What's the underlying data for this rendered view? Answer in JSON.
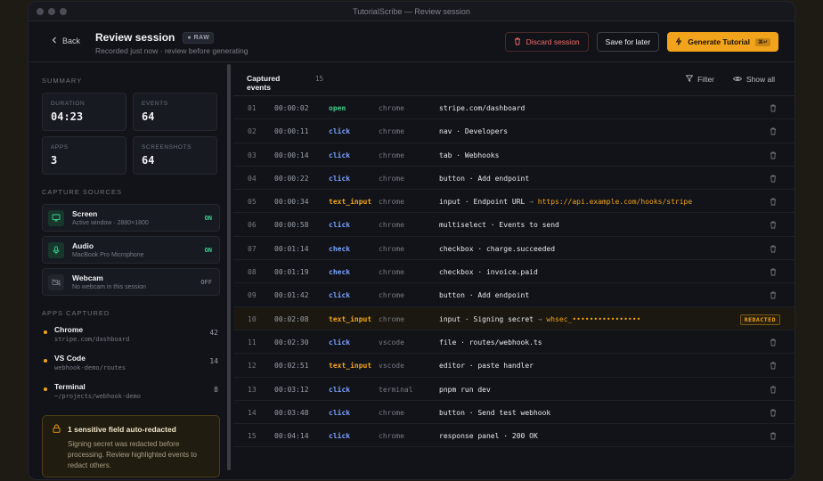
{
  "window": {
    "title": "TutorialScribe — Review session"
  },
  "header": {
    "back": "Back",
    "title": "Review session",
    "badge": "RAW",
    "subtitle": "Recorded just now · review before generating",
    "discard": "Discard session",
    "save": "Save for later",
    "generate": "Generate Tutorial",
    "generate_kbd": "⌘↵"
  },
  "sidebar": {
    "summary_label": "SUMMARY",
    "stats": [
      {
        "label": "DURATION",
        "value": "04:23"
      },
      {
        "label": "EVENTS",
        "value": "64"
      },
      {
        "label": "APPS",
        "value": "3"
      },
      {
        "label": "SCREENSHOTS",
        "value": "64"
      }
    ],
    "sources_label": "CAPTURE SOURCES",
    "sources": [
      {
        "name": "Screen",
        "detail": "Active window · 2880×1800",
        "status": "ON",
        "icon": "monitor-icon"
      },
      {
        "name": "Audio",
        "detail": "MacBook Pro Microphone",
        "status": "ON",
        "icon": "microphone-icon"
      },
      {
        "name": "Webcam",
        "detail": "No webcam in this session",
        "status": "OFF",
        "icon": "webcam-off-icon"
      }
    ],
    "apps_label": "APPS CAPTURED",
    "apps": [
      {
        "name": "Chrome",
        "path": "stripe.com/dashboard",
        "count": "42"
      },
      {
        "name": "VS Code",
        "path": "webhook-demo/routes",
        "count": "14"
      },
      {
        "name": "Terminal",
        "path": "~/projects/webhook-demo",
        "count": "8"
      }
    ],
    "alert": {
      "title": "1 sensitive field auto-redacted",
      "body": "Signing secret was redacted before processing. Review highlighted events to redact others."
    }
  },
  "events": {
    "title_line1": "Captured",
    "title_line2": "events",
    "count": "15",
    "filter": "Filter",
    "show_all": "Show all",
    "colors": {
      "open": "#3ecf8e",
      "click": "#7aa2ff",
      "check": "#7aa2ff",
      "text_input": "#f2a31c"
    },
    "rows": [
      {
        "idx": "01",
        "time": "00:00:02",
        "action": "open",
        "app": "chrome",
        "target": "stripe.com/dashboard",
        "value": "",
        "redacted": false
      },
      {
        "idx": "02",
        "time": "00:00:11",
        "action": "click",
        "app": "chrome",
        "target": "nav · Developers",
        "value": "",
        "redacted": false
      },
      {
        "idx": "03",
        "time": "00:00:14",
        "action": "click",
        "app": "chrome",
        "target": "tab · Webhooks",
        "value": "",
        "redacted": false
      },
      {
        "idx": "04",
        "time": "00:00:22",
        "action": "click",
        "app": "chrome",
        "target": "button · Add endpoint",
        "value": "",
        "redacted": false
      },
      {
        "idx": "05",
        "time": "00:00:34",
        "action": "text_input",
        "app": "chrome",
        "target": "input · Endpoint URL",
        "value": "https://api.example.com/hooks/stripe",
        "redacted": false
      },
      {
        "idx": "06",
        "time": "00:00:58",
        "action": "click",
        "app": "chrome",
        "target": "multiselect · Events to send",
        "value": "",
        "redacted": false
      },
      {
        "idx": "07",
        "time": "00:01:14",
        "action": "check",
        "app": "chrome",
        "target": "checkbox · charge.succeeded",
        "value": "",
        "redacted": false
      },
      {
        "idx": "08",
        "time": "00:01:19",
        "action": "check",
        "app": "chrome",
        "target": "checkbox · invoice.paid",
        "value": "",
        "redacted": false
      },
      {
        "idx": "09",
        "time": "00:01:42",
        "action": "click",
        "app": "chrome",
        "target": "button · Add endpoint",
        "value": "",
        "redacted": false
      },
      {
        "idx": "10",
        "time": "00:02:08",
        "action": "text_input",
        "app": "chrome",
        "target": "input · Signing secret",
        "value": "whsec_••••••••••••••••",
        "redacted": true
      },
      {
        "idx": "11",
        "time": "00:02:30",
        "action": "click",
        "app": "vscode",
        "target": "file · routes/webhook.ts",
        "value": "",
        "redacted": false
      },
      {
        "idx": "12",
        "time": "00:02:51",
        "action": "text_input",
        "app": "vscode",
        "target": "editor · paste handler",
        "value": "",
        "redacted": false
      },
      {
        "idx": "13",
        "time": "00:03:12",
        "action": "click",
        "app": "terminal",
        "target": "pnpm run dev",
        "value": "",
        "redacted": false
      },
      {
        "idx": "14",
        "time": "00:03:48",
        "action": "click",
        "app": "chrome",
        "target": "button · Send test webhook",
        "value": "",
        "redacted": false
      },
      {
        "idx": "15",
        "time": "00:04:14",
        "action": "click",
        "app": "chrome",
        "target": "response panel · 200 OK",
        "value": "",
        "redacted": false
      }
    ],
    "redacted_label": "REDACTED"
  }
}
